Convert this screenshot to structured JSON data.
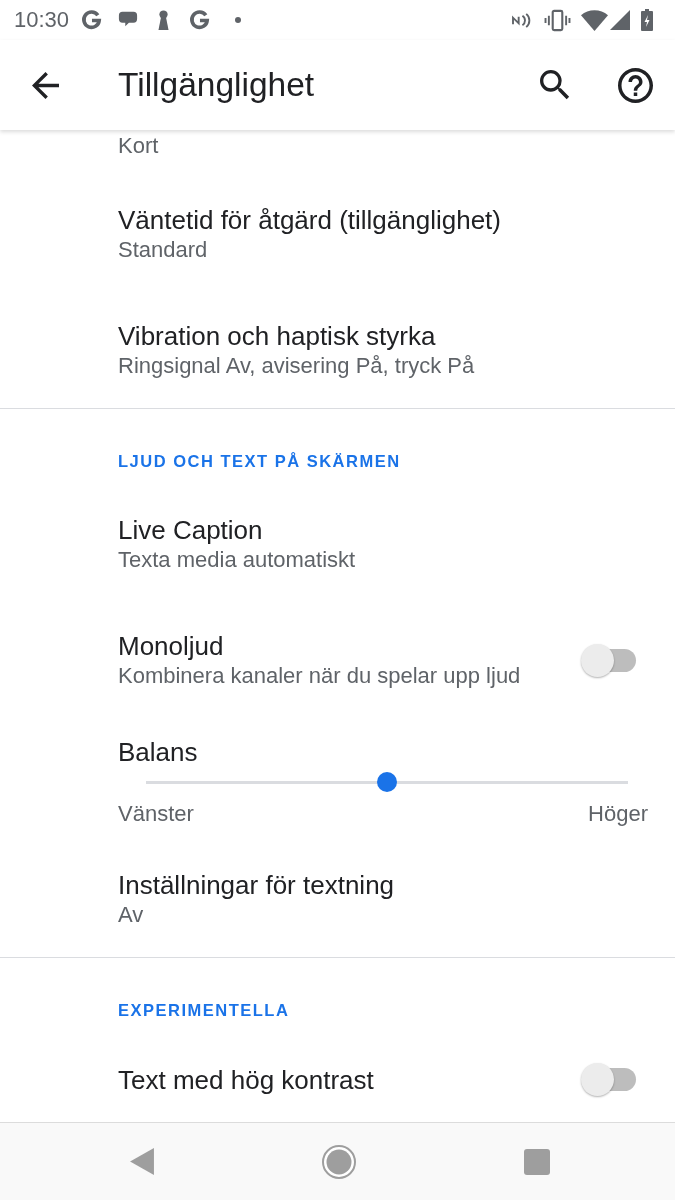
{
  "status_bar": {
    "time": "10:30"
  },
  "app_bar": {
    "title": "Tillgänglighet"
  },
  "sections": [
    {
      "items": [
        {
          "kind": "link",
          "summary": "Kort"
        },
        {
          "kind": "link",
          "title": "Väntetid för åtgärd (tillgänglighet)",
          "summary": "Standard"
        },
        {
          "kind": "link",
          "title": "Vibration och haptisk styrka",
          "summary": "Ringsignal Av, avisering På, tryck På"
        }
      ]
    },
    {
      "header": "LJUD OCH TEXT PÅ SKÄRMEN",
      "items": [
        {
          "kind": "link",
          "title": "Live Caption",
          "summary": "Texta media automatiskt"
        },
        {
          "kind": "switch",
          "title": "Monoljud",
          "summary": "Kombinera kanaler när du spelar upp ljud",
          "on": false
        },
        {
          "kind": "slider",
          "title": "Balans",
          "level": 0.5,
          "min_label": "Vänster",
          "max_label": "Höger"
        },
        {
          "kind": "link",
          "title": "Inställningar för textning",
          "summary": "Av"
        }
      ]
    },
    {
      "header": "EXPERIMENTELLA",
      "items": [
        {
          "kind": "switch",
          "title": "Text med hög kontrast",
          "on": false
        }
      ]
    }
  ]
}
